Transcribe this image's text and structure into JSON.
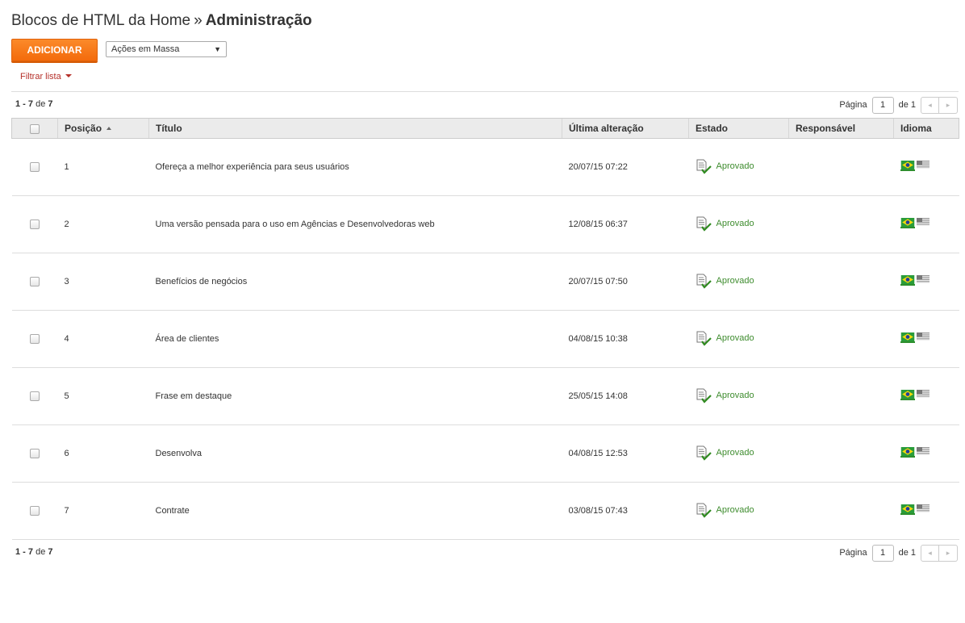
{
  "header": {
    "breadcrumb": "Blocos de HTML da Home",
    "separator": "»",
    "current": "Administração"
  },
  "toolbar": {
    "add_label": "ADICIONAR",
    "mass_actions_selected": "Ações em Massa",
    "filter_label": "Filtrar lista"
  },
  "pagination": {
    "range": "1 - 7",
    "of_label": "de",
    "total": "7",
    "page_label": "Página",
    "page_value": "1",
    "page_of_label": "de 1",
    "prev_icon": "◂",
    "next_icon": "▸"
  },
  "table": {
    "columns": [
      "Posição",
      "Título",
      "Última alteração",
      "Estado",
      "Responsável",
      "Idioma"
    ],
    "rows": [
      {
        "position": "1",
        "title": "Ofereça a melhor experiência para seus usuários",
        "modified": "20/07/15 07:22",
        "status": "Aprovado"
      },
      {
        "position": "2",
        "title": "Uma versão pensada para o uso em Agências e Desenvolvedoras web",
        "modified": "12/08/15 06:37",
        "status": "Aprovado"
      },
      {
        "position": "3",
        "title": "Benefícios de negócios",
        "modified": "20/07/15 07:50",
        "status": "Aprovado"
      },
      {
        "position": "4",
        "title": "Área de clientes",
        "modified": "04/08/15 10:38",
        "status": "Aprovado"
      },
      {
        "position": "5",
        "title": "Frase em destaque",
        "modified": "25/05/15 14:08",
        "status": "Aprovado"
      },
      {
        "position": "6",
        "title": "Desenvolva",
        "modified": "04/08/15 12:53",
        "status": "Aprovado"
      },
      {
        "position": "7",
        "title": "Contrate",
        "modified": "03/08/15 07:43",
        "status": "Aprovado"
      }
    ]
  },
  "colors": {
    "accent": "#f47a1f",
    "filter": "#b5302a",
    "approved": "#3e8c2e"
  },
  "icons": {
    "status": "document-check-icon",
    "lang_pt": "flag-brazil-icon",
    "lang_en": "flag-usa-icon"
  }
}
